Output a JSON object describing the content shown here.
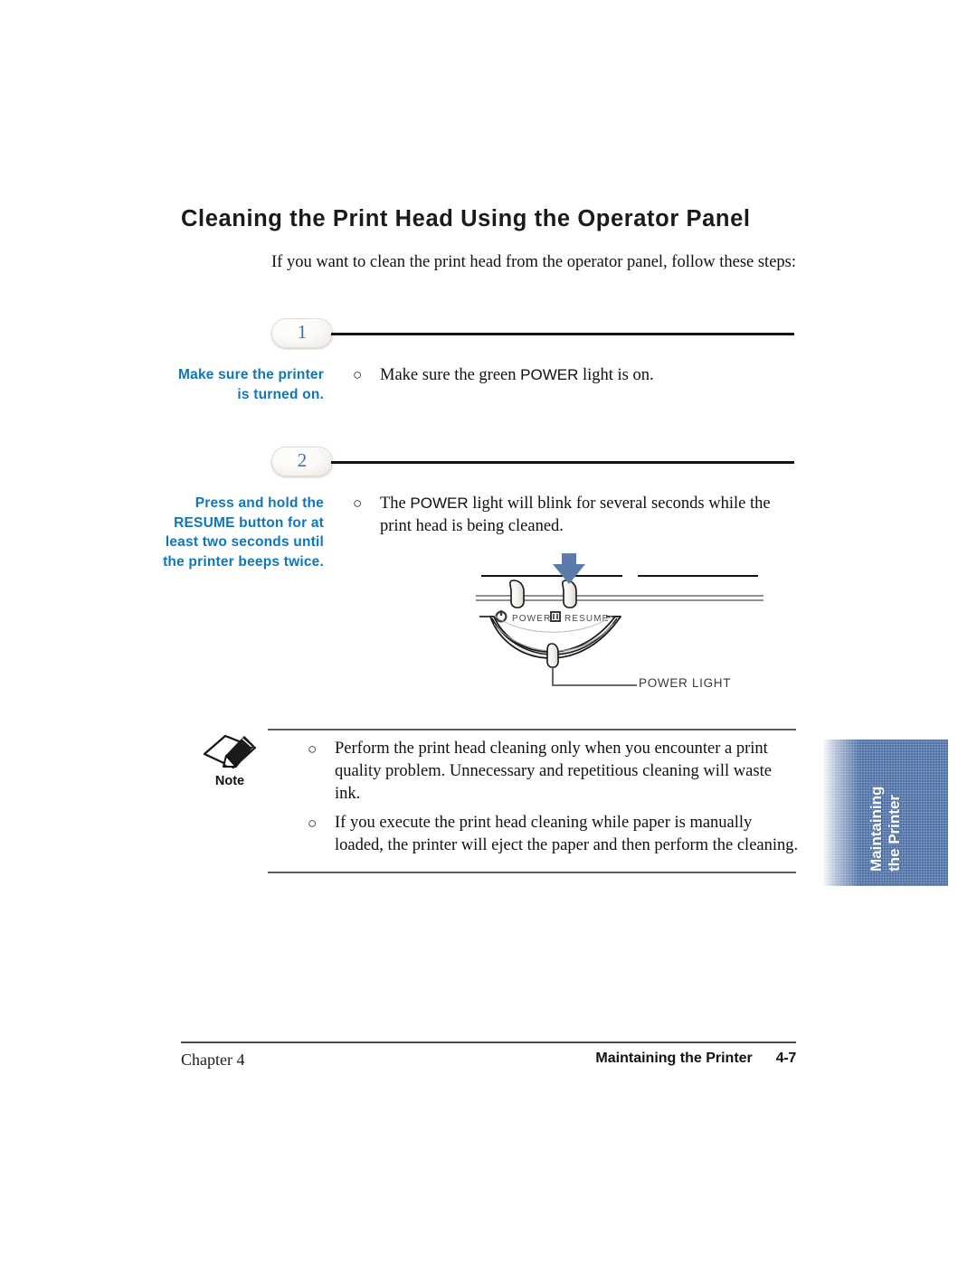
{
  "document": {
    "heading": "Cleaning the Print Head Using the Operator Panel",
    "intro": "If you want to clean the print head from the operator panel, follow these steps:"
  },
  "steps": [
    {
      "number": "1",
      "margin_note": "Make sure the printer is turned on.",
      "bullet_marker": "○",
      "body_pre": "Make sure the green ",
      "body_emphasis": "POWER",
      "body_post": " light is on."
    },
    {
      "number": "2",
      "margin_note": "Press and hold the RESUME button for at least two seconds until the printer beeps twice.",
      "bullet_marker": "○",
      "body_pre": "The ",
      "body_emphasis": "POWER",
      "body_post": " light will blink for several seconds while the print head is being cleaned."
    }
  ],
  "figure": {
    "name": "printer-operator-panel",
    "button_labels": [
      "POWER",
      "RESUME"
    ],
    "callout": "POWER LIGHT",
    "arrow_color": "#5b7cab",
    "arrow_points_to": "RESUME"
  },
  "note": {
    "label": "Note",
    "icon": "note-pencil-paper-icon",
    "bullet_marker": "○",
    "items": [
      "Perform the print head cleaning only when you encounter a print quality problem. Unnecessary and repetitious cleaning will waste ink.",
      "If you execute the print head cleaning while paper is manually loaded, the printer will eject the paper and then perform the cleaning."
    ]
  },
  "side_tab": {
    "line1": "Maintaining",
    "line2": "the Printer",
    "color": "#5273a8"
  },
  "footer": {
    "left": "Chapter 4",
    "section": "Maintaining the Printer",
    "page": "4-7"
  },
  "colors": {
    "margin_note_blue": "#0f76bd",
    "step_number_blue": "#4a6f9e",
    "tab_blue": "#5273a8"
  }
}
